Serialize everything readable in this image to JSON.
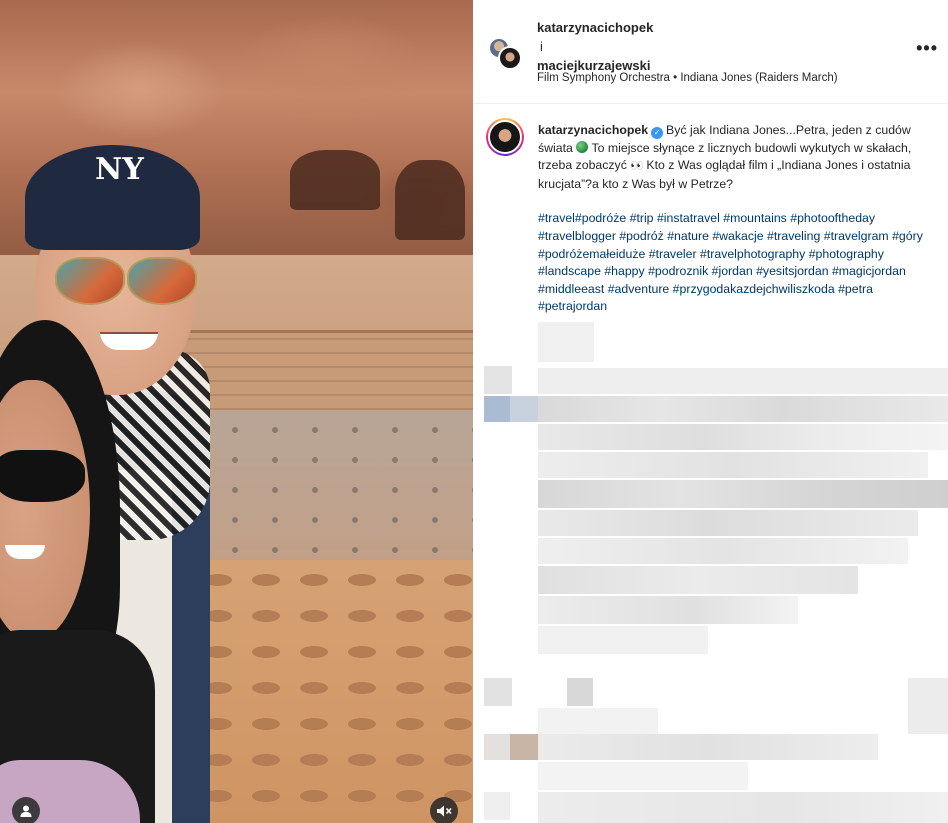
{
  "post": {
    "header": {
      "user1": "katarzynacichopek",
      "separator": "i",
      "user2": "maciejkurzajewski",
      "audio": "Film Symphony Orchestra • Indiana Jones (Raiders March)",
      "more_icon": "more-horizontal-icon"
    },
    "caption": {
      "username": "katarzynacichopek",
      "verified": true,
      "text_part1": "Być jak Indiana Jones...Petra, jeden z cudów świata ",
      "text_part2": " To miejsce słynące z licznych budowli wykutych w skałach, trzeba zobaczyć ",
      "text_part3": " Kto z Was oglądał film i „Indiana Jones i ostatnia krucjata”?a kto z Was był w Petrze?",
      "hashtags": "#travel#podróże #trip #instatravel #mountains #photooftheday #travelblogger #podróż #nature #wakacje #traveling #travelgram #góry #podróżemałeiduże #traveler #travelphotography #photography #landscape #happy #podroznik #jordan #yesitsjordan #magicjordan #middleeast #adventure #przygodakazdejchwiliszkoda #petra #petrajordan"
    },
    "media": {
      "cap_logo": "NY",
      "icons": [
        "user-tag-icon",
        "mute-icon"
      ]
    },
    "colors": {
      "text": "#262626",
      "hashtag": "#00376b",
      "verified": "#3897f0",
      "border": "#efefef"
    }
  }
}
